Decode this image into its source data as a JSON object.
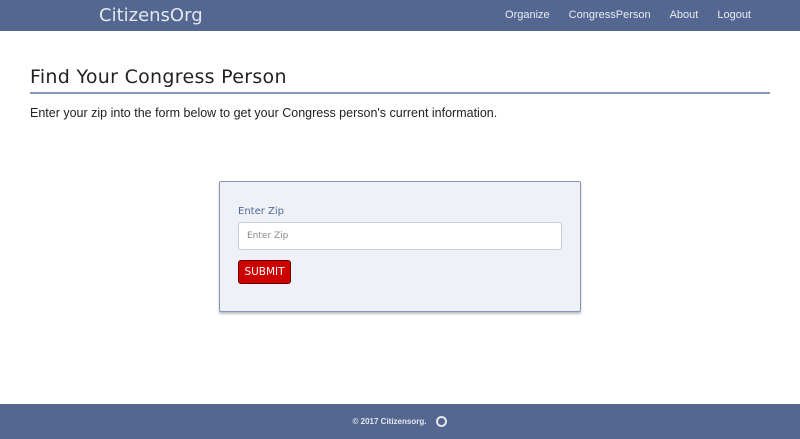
{
  "nav": {
    "brand": "CitizensOrg",
    "links": [
      "Organize",
      "CongressPerson",
      "About",
      "Logout"
    ]
  },
  "main": {
    "title": "Find Your Congress Person",
    "intro": "Enter your zip into the form below to get your Congress person's current information."
  },
  "form": {
    "label": "Enter Zip",
    "placeholder": "Enter Zip",
    "value": "",
    "submit": "SUBMIT"
  },
  "footer": {
    "text": "© 2017 Citizensorg.",
    "icon": "github-icon"
  },
  "colors": {
    "nav": "#536791",
    "submit": "#cc0000"
  }
}
